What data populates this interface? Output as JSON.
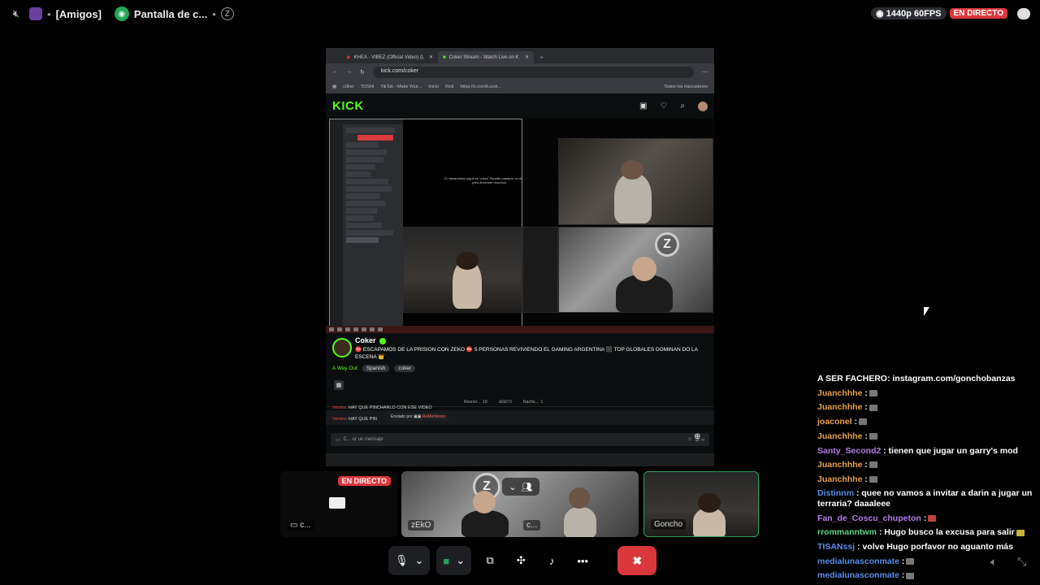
{
  "topbar": {
    "channel": "[Amigos]",
    "app_label": "Pantalla de c...",
    "quality": "1440p 60FPS",
    "live": "EN DIRECTO"
  },
  "browser": {
    "tabs": [
      {
        "label": "KHEA - VIBEZ (Official Video) (L"
      },
      {
        "label": "Coker Stream - Watch Live on K"
      }
    ],
    "url": "kick.com/coker",
    "bookmarks": [
      "c0ker",
      "TOSHI",
      "TikTok - Make Your...",
      "Inicio",
      "Kick",
      "https://x.com/Lucst..."
    ],
    "bookmarks_folder": "Todos los marcadores"
  },
  "kick": {
    "logo": "KICK",
    "stage_message": "¡Tu transmisión sigue en curso! Permite pasando la vista previa para ahorrarte recursos",
    "streamer": "Coker",
    "title": "⛔ ESCAPAMOS DE LA PRISION CON ZEKO ⛔ 5 PERSONAS REVIVIENDO EL GAMING ARGENTINA ⬛ TOP GLOBALES DOMINAN DO LA ESCENA 👑",
    "category": "A Way Out",
    "tags": [
      "Spanish",
      "coker"
    ],
    "leaderboard": [
      {
        "name": "Reoner...",
        "count": "10"
      },
      {
        "name": "zEkO",
        "count": "5"
      },
      {
        "name": "Nacho...",
        "count": "1"
      }
    ],
    "chat_lines": [
      {
        "user": "Ventes",
        "text": ": HAY QUE PINCHARLO CON ESE VIDEO"
      },
      {
        "user": "Ventes",
        "text": ": HAY QUE PIN"
      }
    ],
    "sent_by_label": "Enviado por",
    "sent_by_user": "ReMontesss",
    "input_placeholder": "C... ur un mensaje"
  },
  "tiles": {
    "live": "EN DIRECTO",
    "screen_label": "c...",
    "zeko_label": "zEkO",
    "middle_label": "c...",
    "goncho_label": "Goncho"
  },
  "chat": [
    {
      "user": "A SER FACHERO",
      "color": "#ffffff",
      "text": ": instagram.com/gonchobanzas",
      "emote": ""
    },
    {
      "user": "Juanchhhe",
      "color": "#e8a24b",
      "text": " :",
      "emote": "grey"
    },
    {
      "user": "Juanchhhe",
      "color": "#e8a24b",
      "text": " :",
      "emote": "grey"
    },
    {
      "user": "joaconel",
      "color": "#e8a24b",
      "text": " :",
      "emote": "grey"
    },
    {
      "user": "Juanchhhe",
      "color": "#e8a24b",
      "text": " :",
      "emote": "grey"
    },
    {
      "user": "Santy_Second2",
      "color": "#b47ee8",
      "text": " : tienen que jugar un garry's mod",
      "emote": ""
    },
    {
      "user": "Juanchhhe",
      "color": "#e8a24b",
      "text": " :",
      "emote": "grey"
    },
    {
      "user": "Juanchhhe",
      "color": "#e8a24b",
      "text": " :",
      "emote": "grey"
    },
    {
      "user": "Distinnm",
      "color": "#5a8de8",
      "text": " : quee no vamos a invitar a darin a jugar un terraria? daaaleee",
      "emote": ""
    },
    {
      "user": "Fan_de_Coscu_chupeton",
      "color": "#b47ee8",
      "text": " :",
      "emote": "red"
    },
    {
      "user": "rrommanntwm",
      "color": "#5cd48a",
      "text": " : Hugo busco la excusa para salir",
      "emote": "yellow"
    },
    {
      "user": "TISANssj",
      "color": "#5a8de8",
      "text": " : volve Hugo porfavor no aguanto más",
      "emote": ""
    },
    {
      "user": "medialunasconmate",
      "color": "#5a8de8",
      "text": " :",
      "emote": "grey"
    },
    {
      "user": "medialunasconmate",
      "color": "#5a8de8",
      "text": " :",
      "emote": "grey"
    }
  ]
}
